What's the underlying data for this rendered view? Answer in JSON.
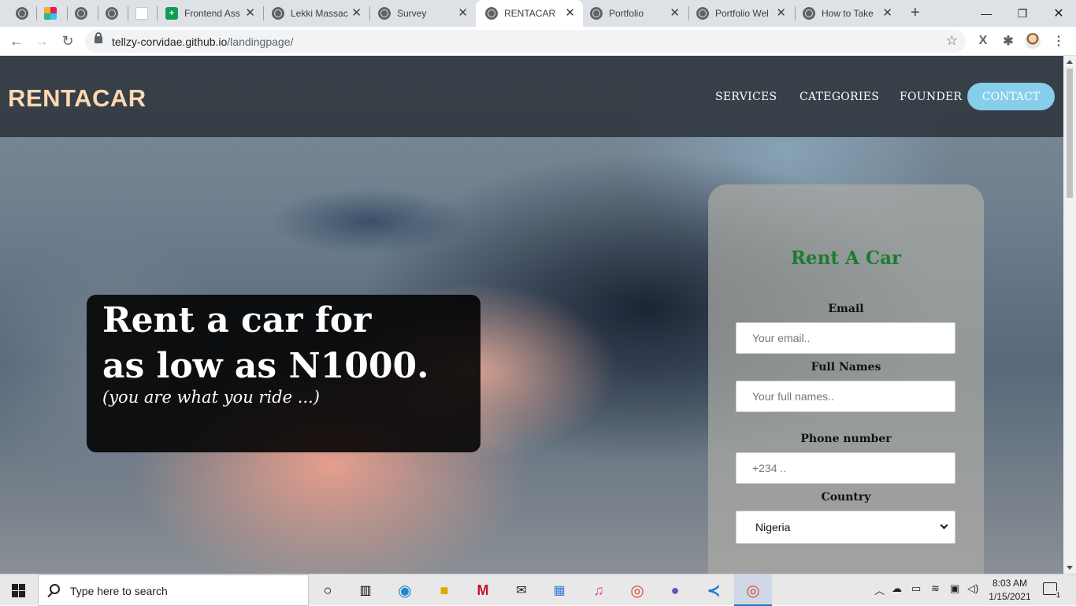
{
  "browser": {
    "tabs": [
      {
        "title": "",
        "icon": "globe-icon"
      },
      {
        "title": "",
        "icon": "slack-icon"
      },
      {
        "title": "",
        "icon": "globe-icon"
      },
      {
        "title": "",
        "icon": "globe-icon"
      },
      {
        "title": "",
        "icon": "document-icon"
      },
      {
        "title": "Frontend Ass",
        "icon": "sheets-icon"
      },
      {
        "title": "Lekki Massac",
        "icon": "globe-icon"
      },
      {
        "title": "Survey",
        "icon": "globe-icon"
      },
      {
        "title": "RENTACAR",
        "icon": "globe-icon",
        "active": true
      },
      {
        "title": "Portfolio",
        "icon": "globe-icon"
      },
      {
        "title": "Portfolio Wel",
        "icon": "globe-icon"
      },
      {
        "title": "How to Take",
        "icon": "globe-icon"
      }
    ],
    "address": {
      "host": "tellzy-corvidae.github.io",
      "path": "/landingpage/"
    }
  },
  "site": {
    "logo": "RENTACAR",
    "nav": {
      "services": "SERVICES",
      "categories": "CATEGORIES",
      "founder": "FOUNDER",
      "contact": "CONTACT"
    },
    "hero": {
      "line1": "Rent a car for",
      "line2": "as low as N1000.",
      "tagline": "(you are what you ride ...)"
    },
    "form": {
      "title": "Rent A Car",
      "email_label": "Email",
      "email_placeholder": "Your email..",
      "name_label": "Full Names",
      "name_placeholder": "Your full names..",
      "phone_label": "Phone number",
      "phone_placeholder": "+234 ..",
      "country_label": "Country",
      "country_selected": "Nigeria"
    }
  },
  "taskbar": {
    "search_placeholder": "Type here to search",
    "time": "8:03 AM",
    "date": "1/15/2021"
  },
  "colors": {
    "logo": "#ffd8b0",
    "contact_button": "#87ceeb",
    "form_title": "#1a7d2e"
  }
}
